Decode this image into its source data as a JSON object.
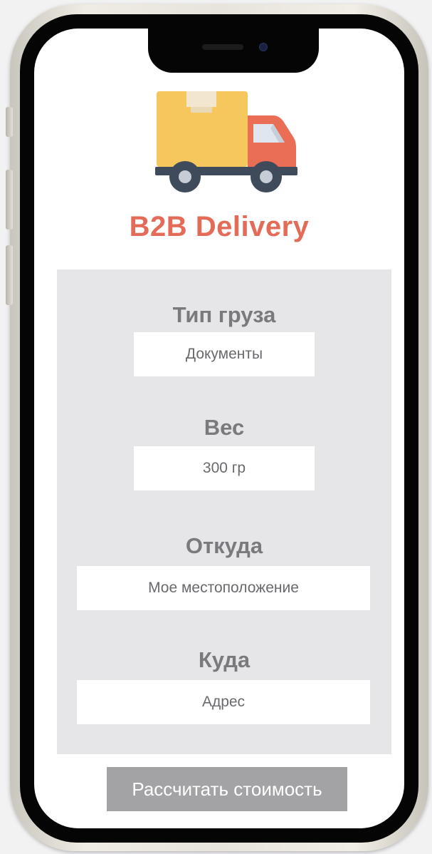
{
  "app": {
    "title": "B2B Delivery"
  },
  "form": {
    "cargo_type": {
      "label": "Тип груза",
      "value": "Документы"
    },
    "weight": {
      "label": "Вес",
      "value": "300 гр"
    },
    "from": {
      "label": "Откуда",
      "value": "Мое местоположение"
    },
    "to": {
      "label": "Куда",
      "value": "Адрес"
    }
  },
  "actions": {
    "calculate_label": "Рассчитать стоимость"
  },
  "icons": {
    "logo": "delivery-truck-icon"
  },
  "colors": {
    "brand": "#e46b57",
    "box": "#f6c75c",
    "panel": "#e6e6e9",
    "button": "#a3a3a5",
    "label": "#7a7a7e"
  }
}
